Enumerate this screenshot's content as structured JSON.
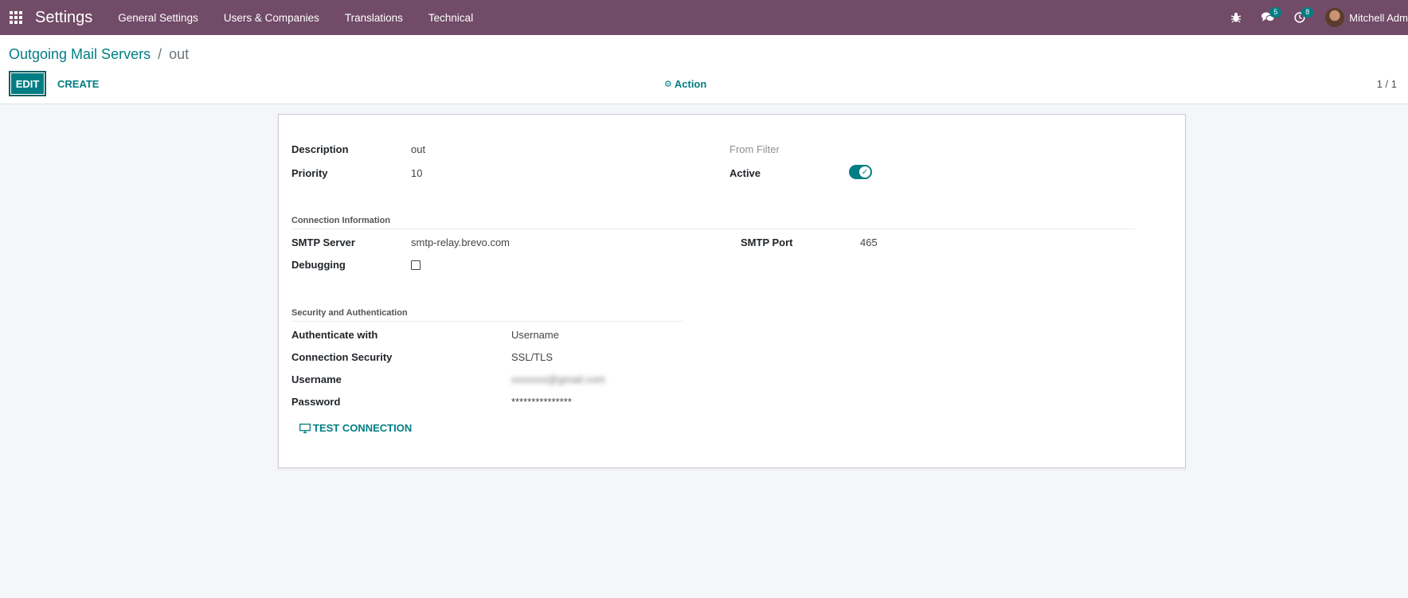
{
  "navbar": {
    "app_title": "Settings",
    "menu": [
      "General Settings",
      "Users & Companies",
      "Translations",
      "Technical"
    ],
    "messages_count": "5",
    "activities_count": "8",
    "user_name": "Mitchell Adm"
  },
  "control_panel": {
    "breadcrumb_parent": "Outgoing Mail Servers",
    "breadcrumb_separator": "/",
    "breadcrumb_current": "out",
    "edit_label": "EDIT",
    "create_label": "CREATE",
    "action_label": "Action",
    "pager": "1 / 1"
  },
  "form": {
    "description_label": "Description",
    "description_value": "out",
    "priority_label": "Priority",
    "priority_value": "10",
    "from_filter_label": "From Filter",
    "active_label": "Active",
    "active_value": true,
    "connection_section": "Connection Information",
    "smtp_server_label": "SMTP Server",
    "smtp_server_value": "smtp-relay.brevo.com",
    "smtp_port_label": "SMTP Port",
    "smtp_port_value": "465",
    "debugging_label": "Debugging",
    "debugging_value": false,
    "security_section": "Security and Authentication",
    "authenticate_label": "Authenticate with",
    "authenticate_value": "Username",
    "conn_security_label": "Connection Security",
    "conn_security_value": "SSL/TLS",
    "username_label": "Username",
    "username_value": "xxxxxxx@gmail.com",
    "password_label": "Password",
    "password_value": "***************",
    "test_connection_label": "TEST CONNECTION"
  },
  "colors": {
    "navbar": "#714b67",
    "primary": "#017e84"
  }
}
